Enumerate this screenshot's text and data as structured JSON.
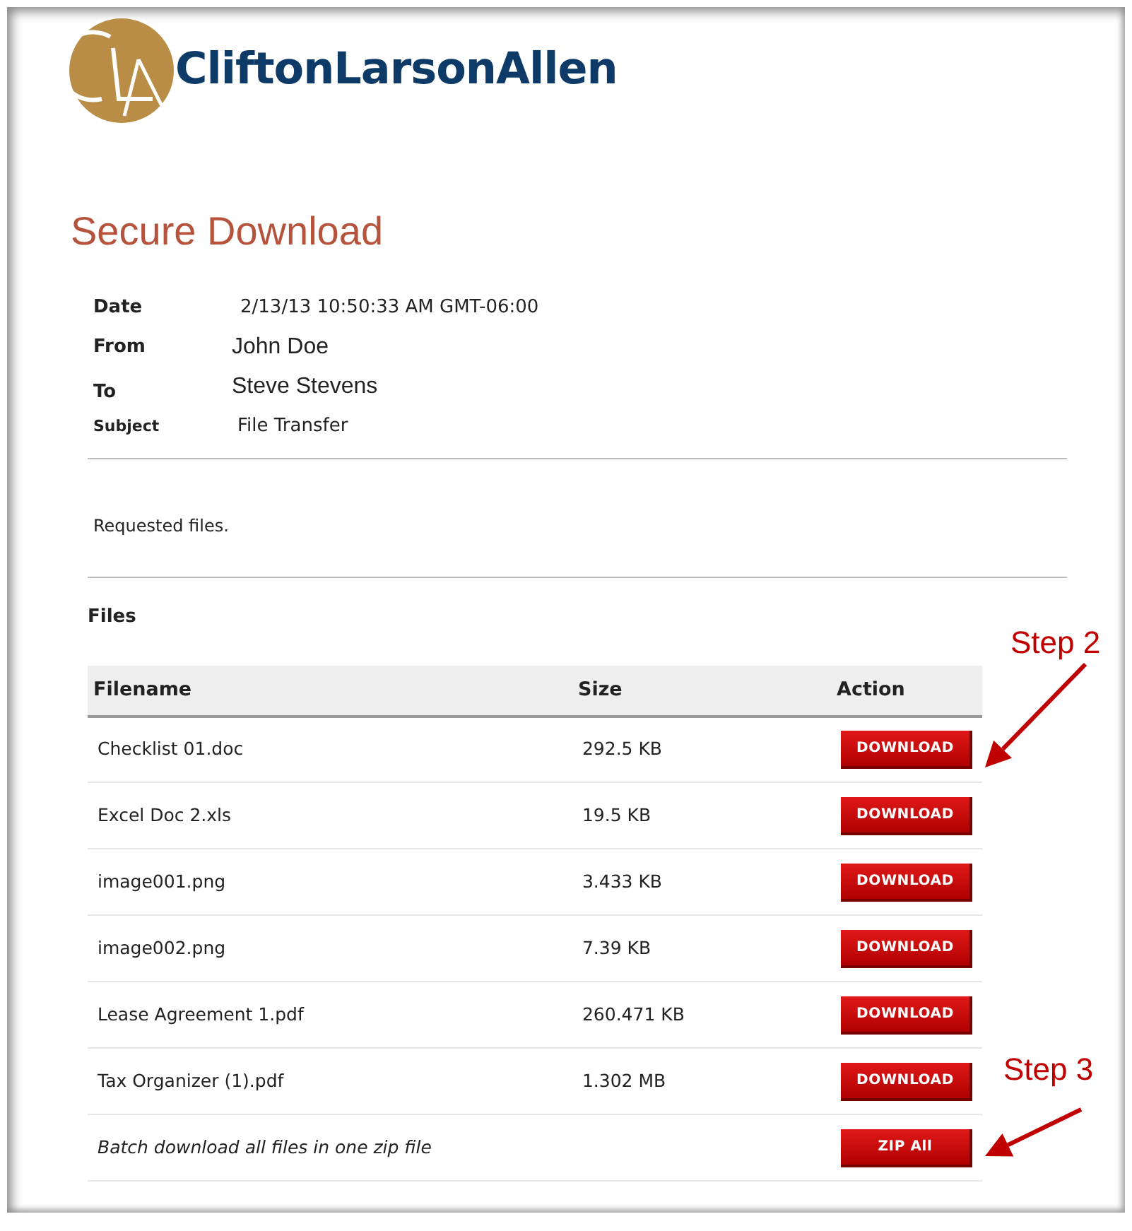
{
  "logo": {
    "text": "CliftonLarsonAllen"
  },
  "title": "Secure Download",
  "meta": [
    {
      "label": "Date",
      "value": "2/13/13 10:50:33 AM GMT-06:00"
    },
    {
      "label": "From",
      "value": "John Doe"
    },
    {
      "label": "To",
      "value": "Steve Stevens"
    },
    {
      "label": "Subject",
      "value": "File Transfer"
    }
  ],
  "message": "Requested files.",
  "files_heading": "Files",
  "table": {
    "columns": [
      "Filename",
      "Size",
      "Action"
    ],
    "rows": [
      {
        "filename": "Checklist 01.doc",
        "size": "292.5 KB",
        "action": "DOWNLOAD"
      },
      {
        "filename": "Excel Doc 2.xls",
        "size": "19.5 KB",
        "action": "DOWNLOAD"
      },
      {
        "filename": "image001.png",
        "size": "3.433 KB",
        "action": "DOWNLOAD"
      },
      {
        "filename": "image002.png",
        "size": "7.39 KB",
        "action": "DOWNLOAD"
      },
      {
        "filename": "Lease Agreement 1.pdf",
        "size": "260.471 KB",
        "action": "DOWNLOAD"
      },
      {
        "filename": "Tax Organizer (1).pdf",
        "size": "1.302 MB",
        "action": "DOWNLOAD"
      }
    ]
  },
  "batch": {
    "text": "Batch download all files in one zip file",
    "action": "ZIP All"
  },
  "annotations": [
    {
      "text": "Step 2"
    },
    {
      "text": "Step 3"
    }
  ]
}
